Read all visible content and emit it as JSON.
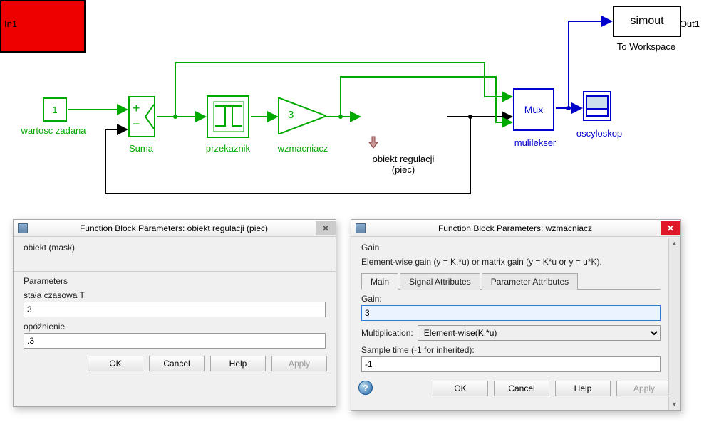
{
  "blocks": {
    "constant": {
      "value": "1",
      "label": "wartosc zadana"
    },
    "sum": {
      "signs_top": "+",
      "signs_bottom": "−",
      "label": "Suma"
    },
    "relay": {
      "label": "przekaznik"
    },
    "gain": {
      "value": "3",
      "label": "wzmacniacz"
    },
    "subsystem": {
      "in": "In1",
      "out": "Out1",
      "label_line1": "obiekt regulacji",
      "label_line2": "(piec)"
    },
    "mux": {
      "text": "Mux",
      "label": "mulilekser"
    },
    "scope": {
      "label": "oscyloskop"
    },
    "toworkspace": {
      "text": "simout",
      "label": "To Workspace"
    }
  },
  "dialog1": {
    "title": "Function Block Parameters: obiekt regulacji (piec)",
    "masktype": "obiekt (mask)",
    "section": "Parameters",
    "param1_label": "stała czasowa T",
    "param1_value": "3",
    "param2_label": "opóźnienie",
    "param2_value": ".3",
    "buttons": {
      "ok": "OK",
      "cancel": "Cancel",
      "help": "Help",
      "apply": "Apply"
    }
  },
  "dialog2": {
    "title": "Function Block Parameters: wzmacniacz",
    "blocktype": "Gain",
    "desc": "Element-wise gain (y = K.*u) or matrix gain (y = K*u or y = u*K).",
    "tabs": [
      "Main",
      "Signal Attributes",
      "Parameter Attributes"
    ],
    "gain_label": "Gain:",
    "gain_value": "3",
    "mult_label": "Multiplication:",
    "mult_value": "Element-wise(K.*u)",
    "sampletime_label": "Sample time (-1 for inherited):",
    "sampletime_value": "-1",
    "buttons": {
      "ok": "OK",
      "cancel": "Cancel",
      "help": "Help",
      "apply": "Apply"
    }
  }
}
